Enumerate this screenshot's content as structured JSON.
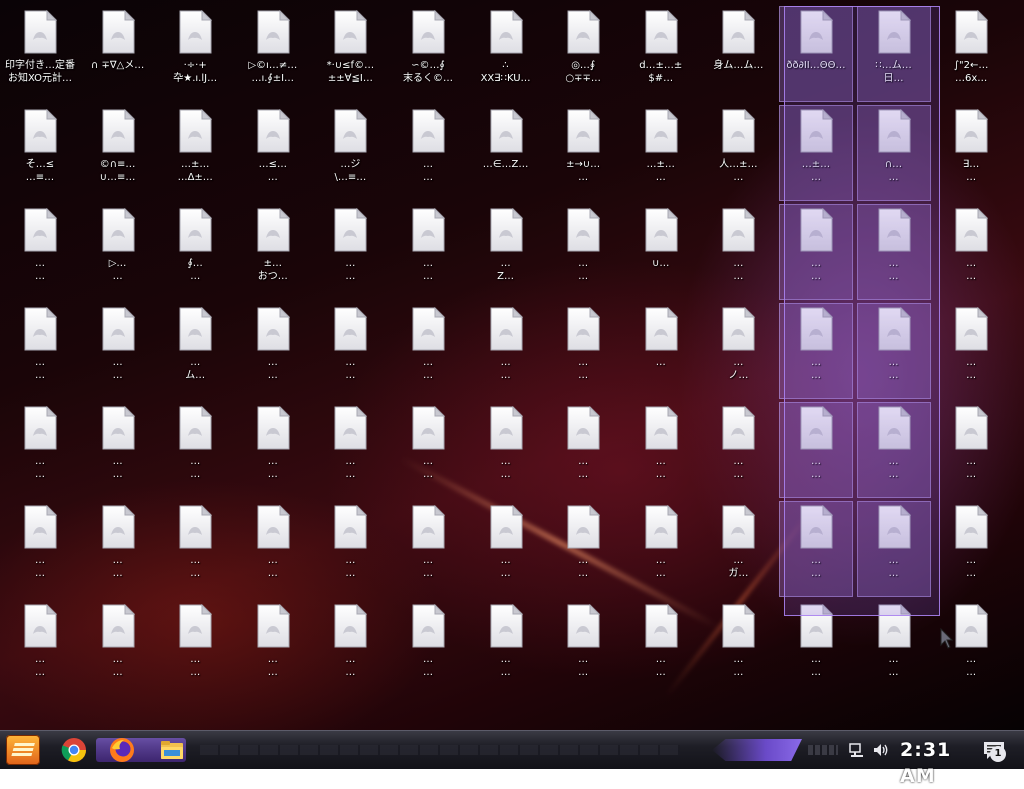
{
  "desktop": {
    "icons": [
      {
        "label": "印字付き…定番\nお知XO元計…"
      },
      {
        "label": "∩ ∓∇△メ…"
      },
      {
        "label": "·÷·+\n卆★.ı.lJ…"
      },
      {
        "label": "▷©ı…≠…\n…ı.∮±I…"
      },
      {
        "label": "*·∪≤f©…\n±±∀≦I…"
      },
      {
        "label": "∽©…∮\n末るく©…"
      },
      {
        "label": "∴\nXX∃∷KU…"
      },
      {
        "label": "◎…∮\n○∓∓…"
      },
      {
        "label": "d…±…±\n$#…"
      },
      {
        "label": "身ム…ム…"
      },
      {
        "label": "ðð∂II…ΘΘ…"
      },
      {
        "label": "∷…ム…\n日…"
      },
      {
        "label": "∫\"2←…\n…6x…"
      },
      {
        "label": "そ…≤\n…≡…"
      },
      {
        "label": "©∩≡…\n∪…≡…"
      },
      {
        "label": "…±…\n…Δ±…"
      },
      {
        "label": "…≤…\n…"
      },
      {
        "label": "…ジ\n\\…≡…"
      },
      {
        "label": "…\n…"
      },
      {
        "label": "…∈…Z…"
      },
      {
        "label": "±→∪…\n…"
      },
      {
        "label": "…±…\n…"
      },
      {
        "label": "人…±…\n…"
      },
      {
        "label": "…±…\n…"
      },
      {
        "label": "∩…\n…"
      },
      {
        "label": "∃…\n…"
      },
      {
        "label": "…\n…"
      },
      {
        "label": "▷…\n…"
      },
      {
        "label": "∮…\n…"
      },
      {
        "label": "±…\nおつ…"
      },
      {
        "label": "…\n…"
      },
      {
        "label": "…\n…"
      },
      {
        "label": "…\nZ…"
      },
      {
        "label": "…\n…"
      },
      {
        "label": "∪…"
      },
      {
        "label": "…\n…"
      },
      {
        "label": "…\n…"
      },
      {
        "label": "…\n…"
      },
      {
        "label": "…\n…"
      },
      {
        "label": "…\n…"
      },
      {
        "label": "…\n…"
      },
      {
        "label": "…\nム…"
      },
      {
        "label": "…\n…"
      },
      {
        "label": "…\n…"
      },
      {
        "label": "…\n…"
      },
      {
        "label": "…\n…"
      },
      {
        "label": "…\n…"
      },
      {
        "label": "…"
      },
      {
        "label": "…\nノ…"
      },
      {
        "label": "…\n…"
      },
      {
        "label": "…\n…"
      },
      {
        "label": "…\n…"
      },
      {
        "label": "…\n…"
      },
      {
        "label": "…\n…"
      },
      {
        "label": "…\n…"
      },
      {
        "label": "…\n…"
      },
      {
        "label": "…\n…"
      },
      {
        "label": "…\n…"
      },
      {
        "label": "…\n…"
      },
      {
        "label": "…\n…"
      },
      {
        "label": "…\n…"
      },
      {
        "label": "…\n…"
      },
      {
        "label": "…\n…"
      },
      {
        "label": "…\n…"
      },
      {
        "label": "…\n…"
      },
      {
        "label": "…\n…"
      },
      {
        "label": "…\n…"
      },
      {
        "label": "…\n…"
      },
      {
        "label": "…\n…"
      },
      {
        "label": "…\n…"
      },
      {
        "label": "…\n…"
      },
      {
        "label": "…\n…"
      },
      {
        "label": "…\n…"
      },
      {
        "label": "…\n…"
      },
      {
        "label": "…\nガ…"
      },
      {
        "label": "…\n…"
      },
      {
        "label": "…\n…"
      },
      {
        "label": "…\n…"
      },
      {
        "label": "…\n…"
      },
      {
        "label": "…\n…"
      },
      {
        "label": "…\n…"
      },
      {
        "label": "…\n…"
      },
      {
        "label": "…\n…"
      },
      {
        "label": "…\n…"
      },
      {
        "label": "…\n…"
      },
      {
        "label": "…\n…"
      },
      {
        "label": "…\n…"
      },
      {
        "label": "…\n…"
      },
      {
        "label": "…\n…"
      },
      {
        "label": "…\n…"
      },
      {
        "label": "…\n…"
      }
    ]
  },
  "taskbar": {
    "clock": "2:31 AM",
    "notification_count": "1"
  }
}
